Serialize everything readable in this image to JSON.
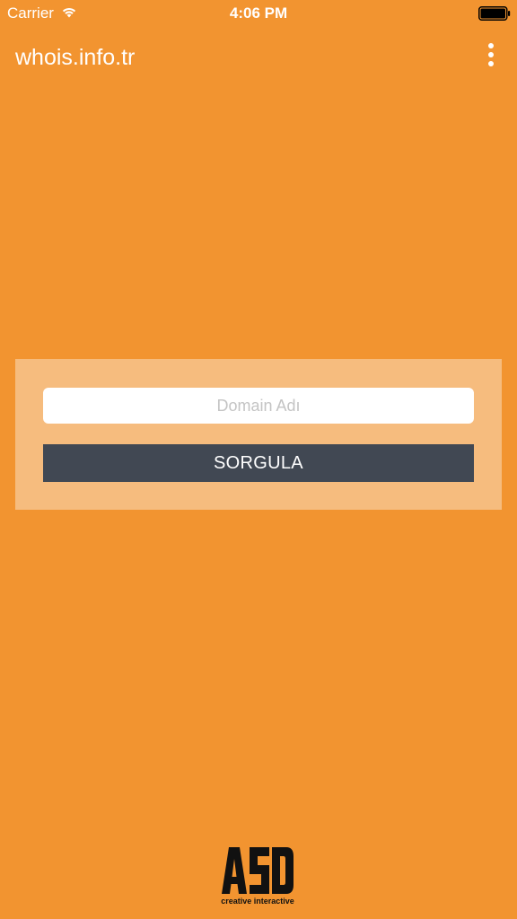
{
  "status_bar": {
    "carrier": "Carrier",
    "time": "4:06 PM",
    "wifi_icon": "wifi-icon",
    "battery_icon": "battery-icon"
  },
  "header": {
    "title": "whois.info.tr",
    "menu_icon": "more-vertical-icon"
  },
  "form": {
    "domain_placeholder": "Domain Adı",
    "domain_value": "",
    "submit_label": "SORGULA"
  },
  "footer": {
    "logo_main": "ASD",
    "logo_sub": "creative interactive"
  },
  "colors": {
    "background": "#F29430",
    "panel": "#F6BC7E",
    "button": "#414853",
    "text": "#FFFFFF"
  }
}
